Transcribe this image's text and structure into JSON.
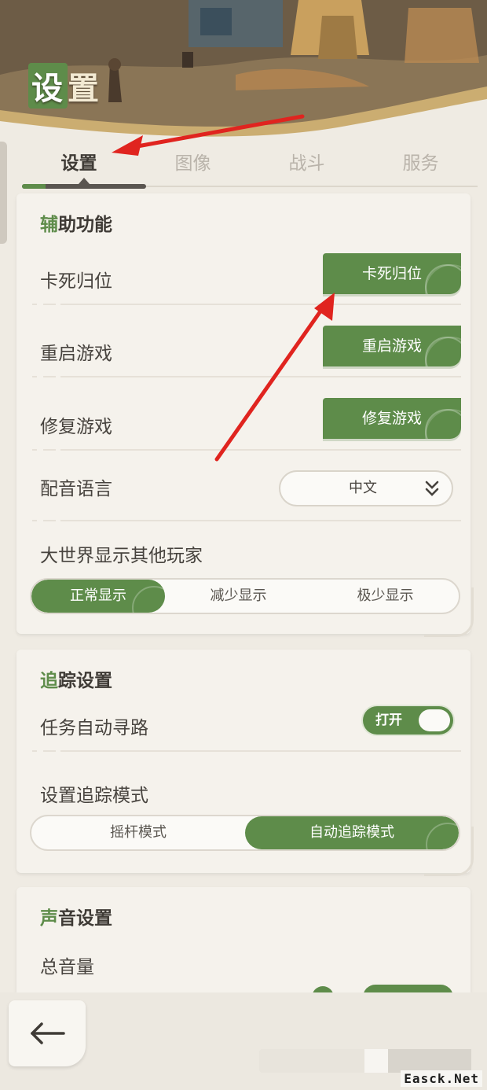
{
  "header": {
    "title": "设置"
  },
  "tabs": [
    {
      "label": "设置",
      "active": true
    },
    {
      "label": "图像",
      "active": false
    },
    {
      "label": "战斗",
      "active": false
    },
    {
      "label": "服务",
      "active": false
    }
  ],
  "assist": {
    "title_accent": "辅",
    "title_rest": "助功能",
    "rows": [
      {
        "label": "卡死归位",
        "button": "卡死归位"
      },
      {
        "label": "重启游戏",
        "button": "重启游戏"
      },
      {
        "label": "修复游戏",
        "button": "修复游戏"
      }
    ],
    "voice_language": {
      "label": "配音语言",
      "value": "中文"
    },
    "world_players": {
      "label": "大世界显示其他玩家",
      "options": [
        "正常显示",
        "减少显示",
        "极少显示"
      ],
      "selected": "正常显示"
    }
  },
  "tracking": {
    "title_accent": "追",
    "title_rest": "踪设置",
    "auto_path": {
      "label": "任务自动寻路",
      "toggle_text": "打开",
      "on": true
    },
    "track_mode": {
      "label": "设置追踪模式",
      "options": [
        "摇杆模式",
        "自动追踪模式"
      ],
      "selected": "自动追踪模式"
    }
  },
  "sound": {
    "title_accent": "声",
    "title_rest": "音设置",
    "master_volume": {
      "label": "总音量"
    }
  },
  "watermark": "Easck.Net",
  "colors": {
    "accent_green": "#5e8c4a",
    "background": "#efebe3",
    "annotation_red": "#e0241f"
  }
}
